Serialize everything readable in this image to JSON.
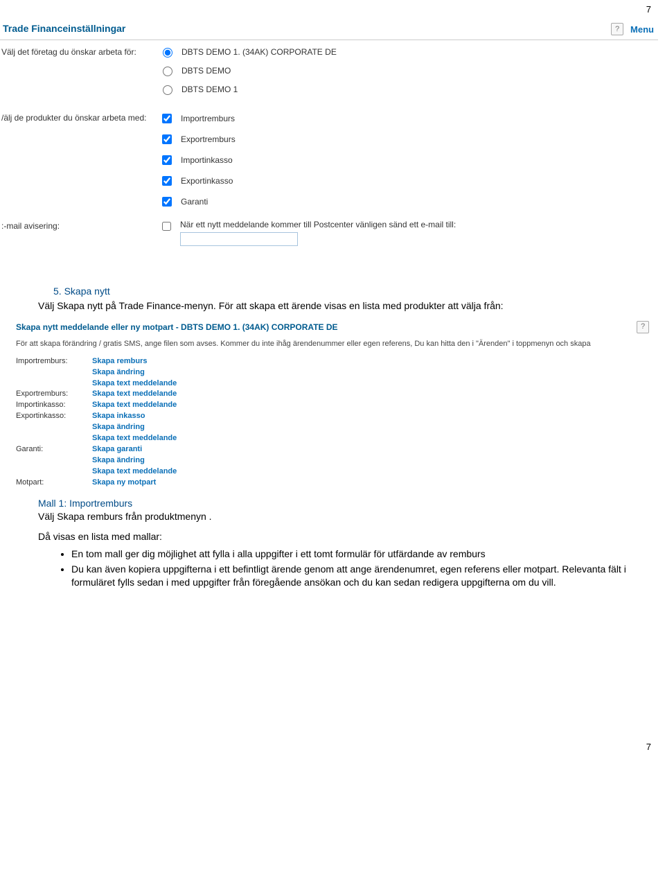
{
  "page_number": "7",
  "settings": {
    "title": "Trade Financeinställningar",
    "menu_label": "Menu",
    "help_glyph": "?",
    "company_label": "Välj det företag du önskar arbeta för:",
    "companies": [
      "DBTS DEMO 1. (34AK) CORPORATE DE",
      "DBTS DEMO",
      "DBTS DEMO 1"
    ],
    "products_label": "/älj de produkter du önskar arbeta med:",
    "products": [
      "Importremburs",
      "Exportremburs",
      "Importinkasso",
      "Exportinkasso",
      "Garanti"
    ],
    "email_label": ":-mail avisering:",
    "email_text": "När ett nytt meddelande kommer till Postcenter vänligen sänd ett e-mail till:"
  },
  "step5": {
    "heading": "5.  Skapa nytt",
    "line1": "Välj Skapa nytt på Trade Finance-menyn. För att skapa ett ärende visas en lista med produkter att välja från:"
  },
  "create_panel": {
    "title": "Skapa nytt meddelande eller ny motpart - DBTS DEMO 1. (34AK) CORPORATE DE",
    "desc": "För att skapa förändring / gratis SMS, ange filen som avses. Kommer du inte ihåg ärendenummer eller egen referens, Du kan hitta den i \"Ärenden\" i toppmenyn och skapa",
    "rows": [
      {
        "label": "Importremburs:",
        "links": [
          "Skapa remburs",
          "Skapa ändring",
          "Skapa text meddelande"
        ]
      },
      {
        "label": "Exportremburs:",
        "links": [
          "Skapa text meddelande"
        ]
      },
      {
        "label": "Importinkasso:",
        "links": [
          "Skapa text meddelande"
        ]
      },
      {
        "label": "Exportinkasso:",
        "links": [
          "Skapa inkasso",
          "Skapa ändring",
          "Skapa text meddelande"
        ]
      },
      {
        "label": "Garanti:",
        "links": [
          "Skapa garanti",
          "Skapa ändring",
          "Skapa text meddelande"
        ]
      },
      {
        "label": "Motpart:",
        "links": [
          "Skapa ny motpart"
        ]
      }
    ]
  },
  "mall1": {
    "heading": "Mall 1: Importremburs",
    "line1": "Välj Skapa remburs från produktmenyn .",
    "line2": "Då visas en lista med mallar:",
    "bullets": [
      "En tom mall ger dig möjlighet att fylla i alla uppgifter i ett tomt formulär för utfärdande av remburs",
      "Du kan även kopiera uppgifterna i ett befintligt ärende genom att ange ärendenumret, egen referens eller motpart. Relevanta fält i formuläret fylls sedan i med uppgifter från föregående ansökan och du kan sedan redigera uppgifterna om du vill."
    ]
  }
}
